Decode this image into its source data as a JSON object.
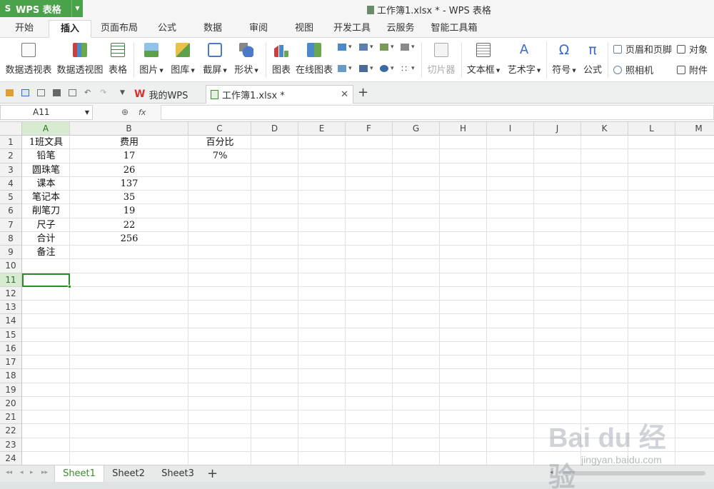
{
  "app": {
    "logo_letter": "S",
    "name": "WPS 表格"
  },
  "window": {
    "title": "工作簿1.xlsx * - WPS 表格"
  },
  "ribbon_tabs": [
    {
      "label": "开始"
    },
    {
      "label": "插入"
    },
    {
      "label": "页面布局"
    },
    {
      "label": "公式"
    },
    {
      "label": "数据"
    },
    {
      "label": "审阅"
    },
    {
      "label": "视图"
    },
    {
      "label": "开发工具"
    },
    {
      "label": "云服务"
    },
    {
      "label": "智能工具箱"
    }
  ],
  "active_ribbon_tab": "插入",
  "ribbon": {
    "pivot_table": "数据透视表",
    "pivot_chart": "数据透视图",
    "table": "表格",
    "picture": "图片",
    "gallery": "图库",
    "screenshot": "截屏",
    "shapes": "形状",
    "chart": "图表",
    "online_chart": "在线图表",
    "slicer": "切片器",
    "textbox": "文本框",
    "wordart": "艺术字",
    "symbol": "符号",
    "equation": "公式",
    "header_footer": "页眉和页脚",
    "object": "对象",
    "camera": "照相机",
    "attachment": "附件",
    "symbol_glyph": "Ω",
    "equation_glyph": "π",
    "wordart_glyph": "A"
  },
  "doc_tabs": [
    {
      "label": "我的WPS"
    },
    {
      "label": "工作簿1.xlsx *"
    }
  ],
  "formula_bar": {
    "name_box": "A11",
    "fx_label": "fx",
    "value": ""
  },
  "columns": [
    "A",
    "B",
    "C",
    "D",
    "E",
    "F",
    "G",
    "H",
    "I",
    "J",
    "K",
    "L",
    "M"
  ],
  "rows": [
    "1",
    "2",
    "3",
    "4",
    "5",
    "6",
    "7",
    "8",
    "9",
    "10",
    "11",
    "12",
    "13",
    "14",
    "15",
    "16",
    "17",
    "18",
    "19",
    "20",
    "21",
    "22",
    "23",
    "24"
  ],
  "cells": {
    "A1": "1班文具",
    "B1": "费用",
    "C1": "百分比",
    "A2": "铅笔",
    "B2": "17",
    "C2": "7%",
    "A3": "圆珠笔",
    "B3": "26",
    "A4": "课本",
    "B4": "137",
    "A5": "笔记本",
    "B5": "35",
    "A6": "削笔刀",
    "B6": "19",
    "A7": "尺子",
    "B7": "22",
    "A8": "合计",
    "B8": "256",
    "A9": "备注"
  },
  "selected_cell": "A11",
  "sheets": [
    {
      "label": "Sheet1"
    },
    {
      "label": "Sheet2"
    },
    {
      "label": "Sheet3"
    }
  ],
  "active_sheet": "Sheet1",
  "add_sheet_glyph": "+",
  "watermark": {
    "brand": "Bai du 经验",
    "url": "jingyan.baidu.com"
  },
  "colors": {
    "accent_green": "#4aa34a",
    "selection_green": "#2f8a2f",
    "wps_red": "#d9302a"
  }
}
